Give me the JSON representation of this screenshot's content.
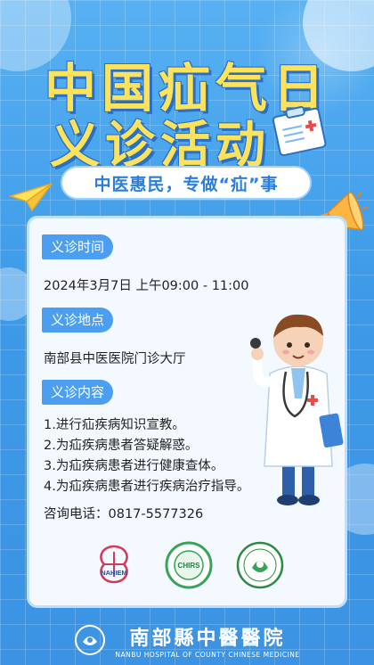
{
  "poster": {
    "title_line1": "中国疝气日",
    "title_line2": "义诊活动",
    "slogan": "中医惠民，专做“疝”事"
  },
  "sections": {
    "time_label": "义诊时间",
    "time_value": "2024年3月7日  上午09:00 - 11:00",
    "place_label": "义诊地点",
    "place_value": "南部县中医医院门诊大厅",
    "content_label": "义诊内容",
    "content_items": [
      "1.进行疝疾病知识宣教。",
      "2.为疝疾病患者答疑解惑。",
      "3.为疝疾病患者进行健康查体。",
      "4.为疝疾病患者进行疾病治疗指导。"
    ],
    "phone": "咨询电话：0817-5577326"
  },
  "logos": {
    "logo1_text": "NAHIEM",
    "logo2_text": "CHIRS"
  },
  "footer": {
    "hospital_name": "南部縣中醫醫院",
    "hospital_english": "NANBU HOSPITAL OF COUNTY CHINESE MEDICINE"
  },
  "colors": {
    "background": "#4aa6ee",
    "title": "#fde35c",
    "label": "#4c9ff0",
    "accent": "#2c7ede"
  }
}
